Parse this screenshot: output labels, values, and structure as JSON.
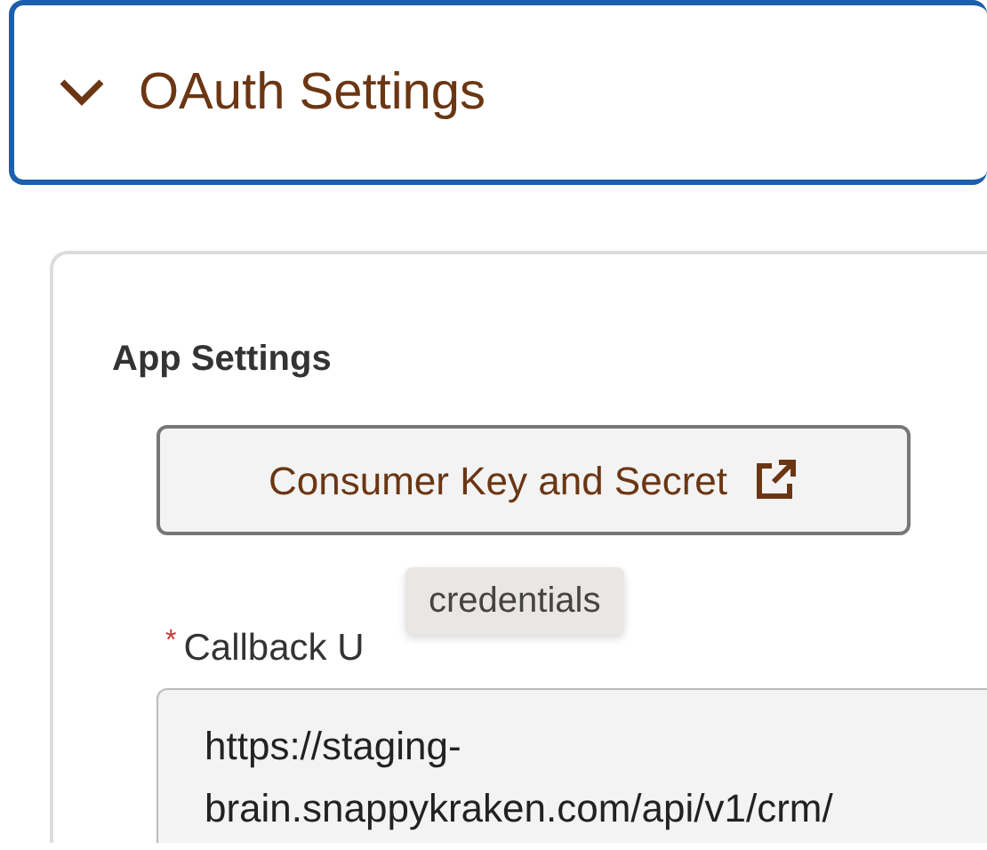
{
  "section": {
    "title": "OAuth Settings",
    "expanded": true
  },
  "app_settings": {
    "heading": "App Settings",
    "button": {
      "label": "Consumer Key and Secret"
    },
    "tooltip": "credentials",
    "callback_url": {
      "required_mark": "*",
      "label": "Callback U",
      "value": "https://staging-brain.snappykraken.com/api/v1/crm/"
    }
  }
}
